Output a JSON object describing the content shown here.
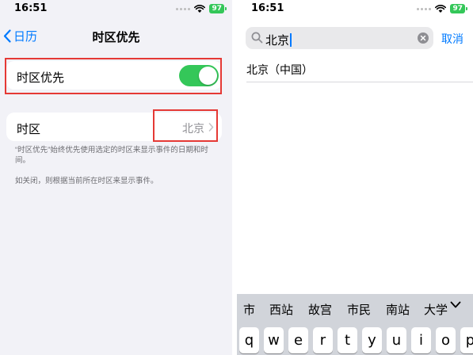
{
  "left": {
    "status": {
      "time": "16:51",
      "battery": "97"
    },
    "nav": {
      "back_label": "日历",
      "title": "时区优先"
    },
    "toggle_row": {
      "label": "时区优先",
      "on": true
    },
    "timezone_row": {
      "label": "时区",
      "value": "北京"
    },
    "footnote_1": "“时区优先”始终优先使用选定的时区来显示事件的日期和时间。",
    "footnote_2": "如关闭，则根据当前所在时区来显示事件。"
  },
  "right": {
    "status": {
      "time": "16:51",
      "battery": "97"
    },
    "search": {
      "query": "北京",
      "cancel_label": "取消"
    },
    "results": [
      "北京（中国）"
    ],
    "keyboard": {
      "suggestions": [
        "市",
        "西站",
        "故宫",
        "市民",
        "南站",
        "大学"
      ],
      "row1": [
        "q",
        "w",
        "e",
        "r",
        "t",
        "y",
        "u",
        "i",
        "o",
        "p"
      ]
    }
  },
  "colors": {
    "accent": "#007aff",
    "toggle_on": "#34c759",
    "highlight": "#e53935"
  },
  "icons": [
    "back-chevron-icon",
    "wifi-icon",
    "battery-icon",
    "chevron-right-icon",
    "search-icon",
    "clear-icon",
    "keyboard-collapse-icon"
  ]
}
